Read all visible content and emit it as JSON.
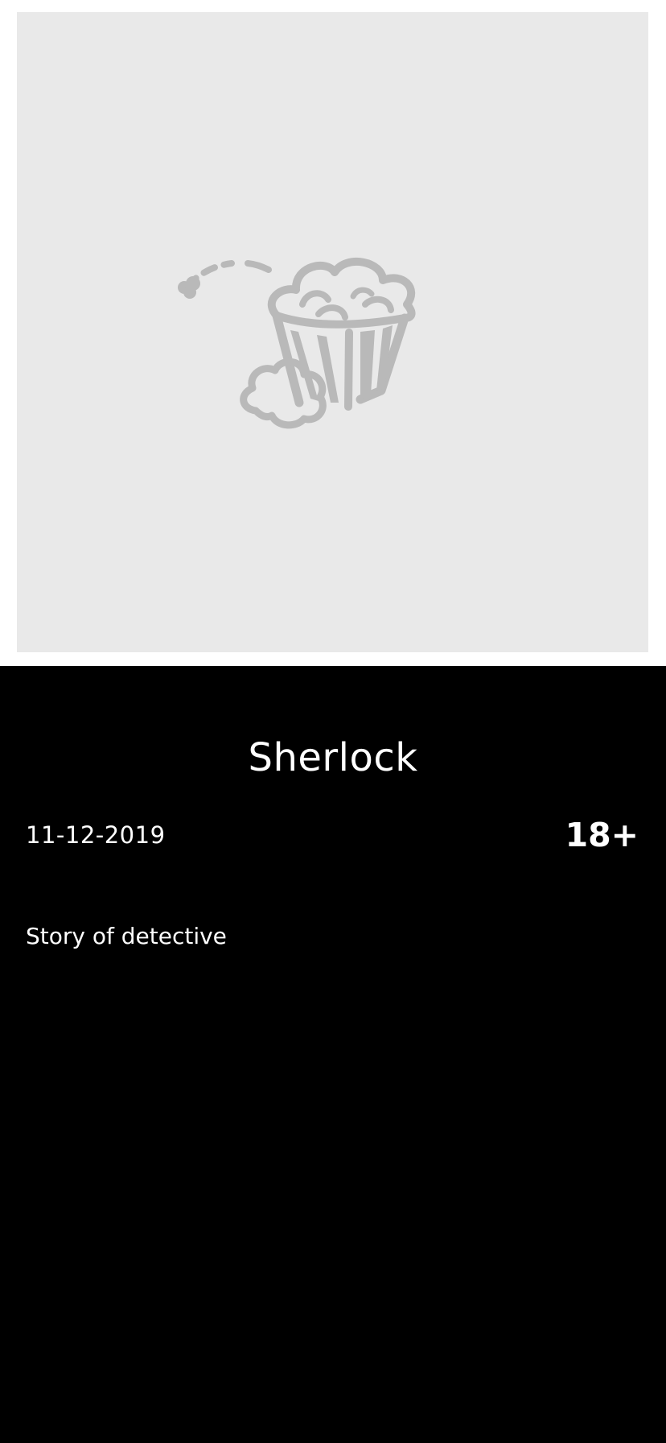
{
  "poster": {
    "icon": "popcorn-icon",
    "background_color": "#e9e9e9",
    "icon_color": "#b9b9b9"
  },
  "movie": {
    "title": "Sherlock",
    "release_date": "11-12-2019",
    "age_rating": "18+",
    "description": "Story of detective"
  },
  "colors": {
    "details_background": "#000000",
    "text": "#ffffff"
  }
}
